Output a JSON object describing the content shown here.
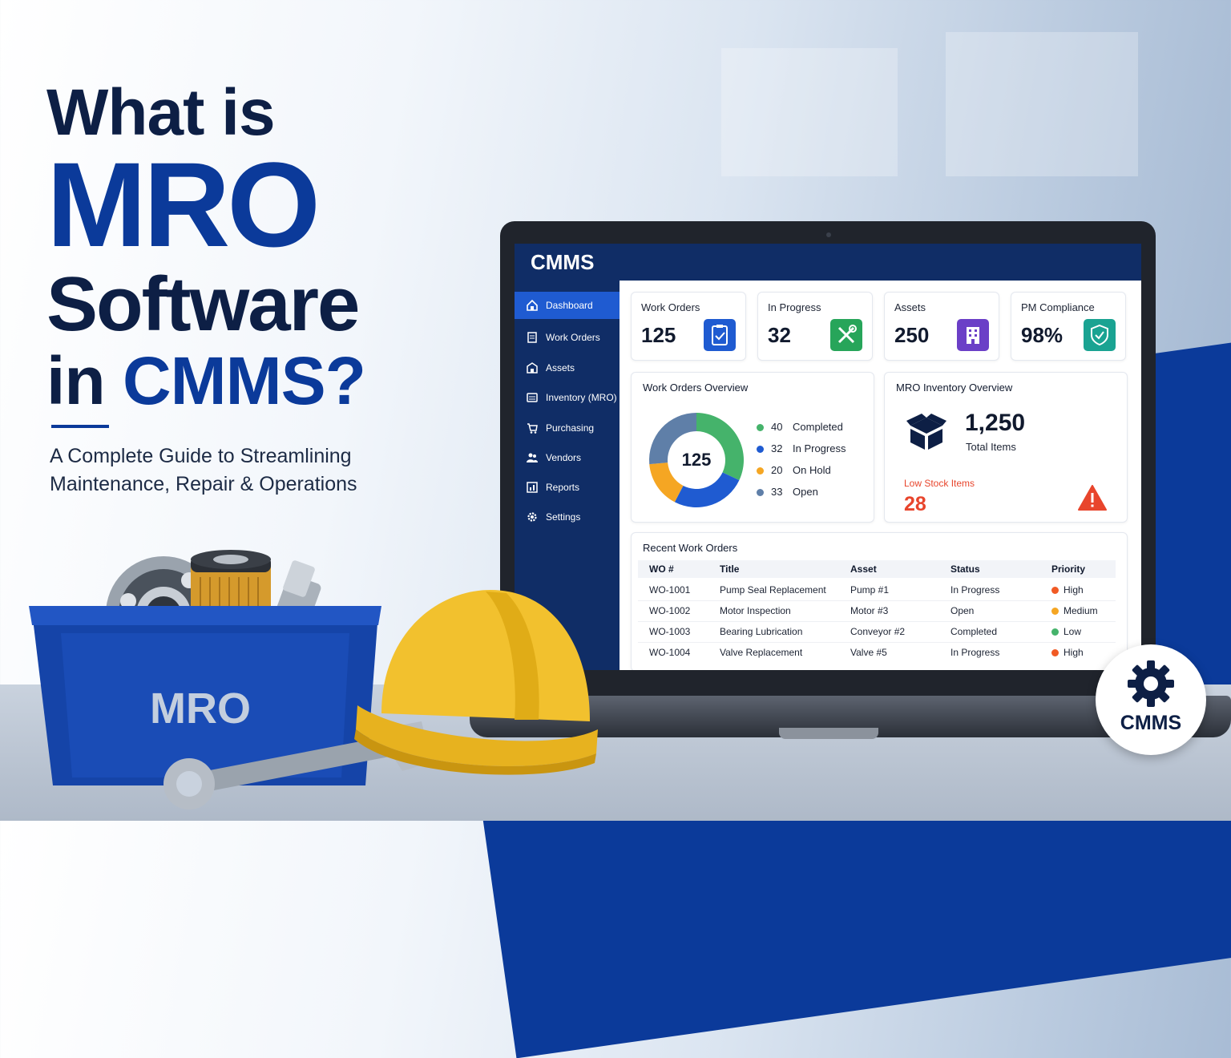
{
  "headline": {
    "line1": "What is",
    "line2": "MRO",
    "line3": "Software",
    "line4_prefix": "in ",
    "line4_highlight": "CMMS?",
    "subtitle_line1": "A Complete Guide to Streamlining",
    "subtitle_line2": "Maintenance, Repair & Operations"
  },
  "app": {
    "title": "CMMS",
    "sidebar": [
      {
        "label": "Dashboard",
        "icon": "home-icon",
        "active": true
      },
      {
        "label": "Work Orders",
        "icon": "clipboard-icon",
        "active": false
      },
      {
        "label": "Assets",
        "icon": "building-icon",
        "active": false
      },
      {
        "label": "Inventory (MRO)",
        "icon": "inventory-icon",
        "active": false
      },
      {
        "label": "Purchasing",
        "icon": "cart-icon",
        "active": false
      },
      {
        "label": "Vendors",
        "icon": "users-icon",
        "active": false
      },
      {
        "label": "Reports",
        "icon": "report-icon",
        "active": false
      },
      {
        "label": "Settings",
        "icon": "gear-icon",
        "active": false
      }
    ],
    "stats": [
      {
        "label": "Work Orders",
        "value": "125",
        "icon": "clipboard-check-icon",
        "color": "#1f5bd1"
      },
      {
        "label": "In Progress",
        "value": "32",
        "icon": "tools-icon",
        "color": "#27a55a"
      },
      {
        "label": "Assets",
        "value": "250",
        "icon": "building-icon",
        "color": "#6b3fc7"
      },
      {
        "label": "PM Compliance",
        "value": "98%",
        "icon": "shield-check-icon",
        "color": "#1aa392"
      }
    ],
    "wo_overview": {
      "title": "Work Orders Overview",
      "total": "125",
      "segments": [
        {
          "value": 40,
          "label": "Completed",
          "color": "#45b36b"
        },
        {
          "value": 32,
          "label": "In Progress",
          "color": "#1f5bd1"
        },
        {
          "value": 20,
          "label": "On Hold",
          "color": "#f5a623"
        },
        {
          "value": 33,
          "label": "Open",
          "color": "#5f7fa8"
        }
      ]
    },
    "inventory": {
      "title": "MRO Inventory Overview",
      "total": "1,250",
      "total_label": "Total Items",
      "low_label": "Low Stock Items",
      "low_value": "28"
    },
    "recent": {
      "title": "Recent Work Orders",
      "columns": [
        "WO #",
        "Title",
        "Asset",
        "Status",
        "Priority"
      ],
      "rows": [
        {
          "wo": "WO-1001",
          "title": "Pump Seal Replacement",
          "asset": "Pump #1",
          "status": "In Progress",
          "priority": "High",
          "pcolor": "#f15a24"
        },
        {
          "wo": "WO-1002",
          "title": "Motor Inspection",
          "asset": "Motor #3",
          "status": "Open",
          "priority": "Medium",
          "pcolor": "#f5a623"
        },
        {
          "wo": "WO-1003",
          "title": "Bearing Lubrication",
          "asset": "Conveyor #2",
          "status": "Completed",
          "priority": "Low",
          "pcolor": "#45b36b"
        },
        {
          "wo": "WO-1004",
          "title": "Valve Replacement",
          "asset": "Valve #5",
          "status": "In Progress",
          "priority": "High",
          "pcolor": "#f15a24"
        }
      ]
    }
  },
  "props": {
    "bin_label": "MRO",
    "badge_label": "CMMS"
  },
  "colors": {
    "brand_blue": "#0b3a9a",
    "navy": "#102d66",
    "alert_red": "#e8452c"
  }
}
